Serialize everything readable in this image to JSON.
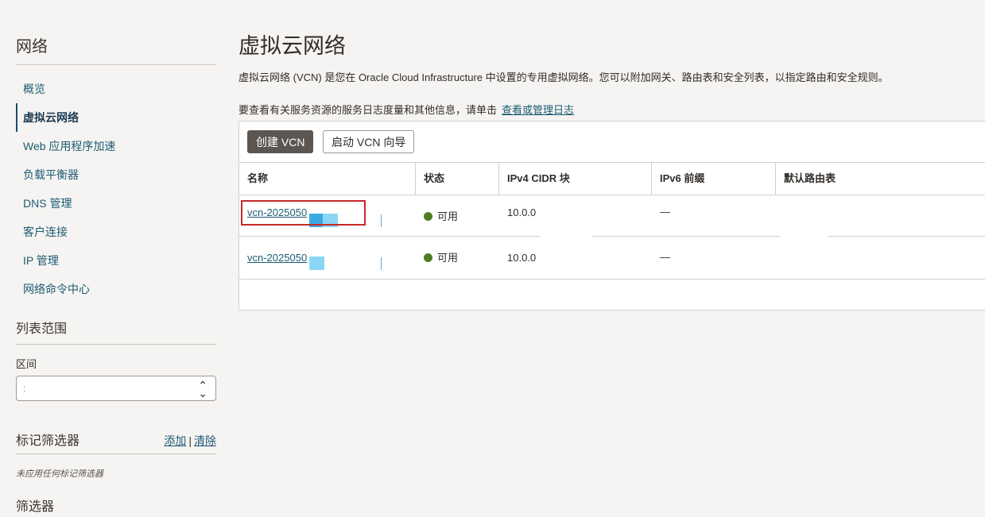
{
  "sidebar": {
    "title": "网络",
    "nav": [
      {
        "label": "概览",
        "active": false
      },
      {
        "label": "虚拟云网络",
        "active": true
      },
      {
        "label": "Web 应用程序加速",
        "active": false
      },
      {
        "label": "负载平衡器",
        "active": false
      },
      {
        "label": "DNS 管理",
        "active": false
      },
      {
        "label": "客户连接",
        "active": false
      },
      {
        "label": "IP 管理",
        "active": false
      },
      {
        "label": "网络命令中心",
        "active": false
      }
    ],
    "list_scope": {
      "title": "列表范围",
      "compartment_label": "区间",
      "compartment_value": ":"
    },
    "tag_filters": {
      "title": "标记筛选器",
      "add": "添加",
      "separator": "|",
      "clear": "清除",
      "note": "未应用任何标记筛选器"
    },
    "filters_title": "筛选器"
  },
  "main": {
    "title": "虚拟云网络",
    "description": "虚拟云网络 (VCN) 是您在 Oracle Cloud Infrastructure 中设置的专用虚拟网络。您可以附加网关、路由表和安全列表，以指定路由和安全规则。",
    "logs_text": "要查看有关服务资源的服务日志度量和其他信息，请单击",
    "logs_link": "查看或管理日志",
    "create_button": "创建 VCN",
    "wizard_button": "启动 VCN 向导",
    "columns": [
      "名称",
      "状态",
      "IPv4 CIDR 块",
      "IPv6 前缀",
      "默认路由表"
    ],
    "rows": [
      {
        "name": "vcn-2025050",
        "status": "可用",
        "ipv4": "10.0.0",
        "ipv6": "—",
        "route_table": ""
      },
      {
        "name": "vcn-2025050",
        "status": "可用",
        "ipv4": "10.0.0",
        "ipv6": "—",
        "route_table": ""
      }
    ],
    "colors": {
      "status_available": "#4f7d23",
      "highlight": "#c62828"
    }
  }
}
